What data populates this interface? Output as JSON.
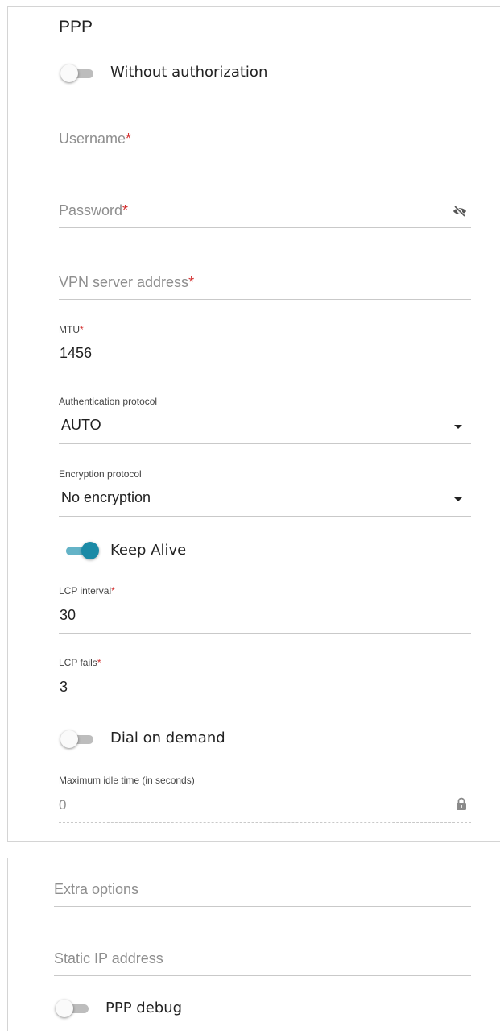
{
  "ppp": {
    "title": "PPP",
    "without_auth": {
      "label": "Without authorization",
      "on": false
    },
    "username": {
      "placeholder": "Username",
      "required_mark": "*"
    },
    "password": {
      "placeholder": "Password",
      "required_mark": "*",
      "visibility_icon": "eye-off-icon"
    },
    "vpn_server": {
      "placeholder": "VPN server address",
      "required_mark": "*"
    },
    "mtu": {
      "label": "MTU",
      "required_mark": "*",
      "value": "1456"
    },
    "auth_protocol": {
      "label": "Authentication protocol",
      "value": "AUTO"
    },
    "encryption_protocol": {
      "label": "Encryption protocol",
      "value": "No encryption"
    },
    "keep_alive": {
      "label": "Keep Alive",
      "on": true
    },
    "lcp_interval": {
      "label": "LCP interval",
      "required_mark": "*",
      "value": "30"
    },
    "lcp_fails": {
      "label": "LCP fails",
      "required_mark": "*",
      "value": "3"
    },
    "dial_on_demand": {
      "label": "Dial on demand",
      "on": false
    },
    "max_idle": {
      "label": "Maximum idle time (in seconds)",
      "value": "0",
      "lock_icon": "lock-icon"
    }
  },
  "extra": {
    "extra_options": {
      "placeholder": "Extra options"
    },
    "static_ip": {
      "placeholder": "Static IP address"
    },
    "ppp_debug": {
      "label": "PPP debug",
      "on": false
    }
  },
  "colors": {
    "accent": "#1b8aa6",
    "accent_track": "#64b3c7",
    "required": "#d32f2f"
  }
}
